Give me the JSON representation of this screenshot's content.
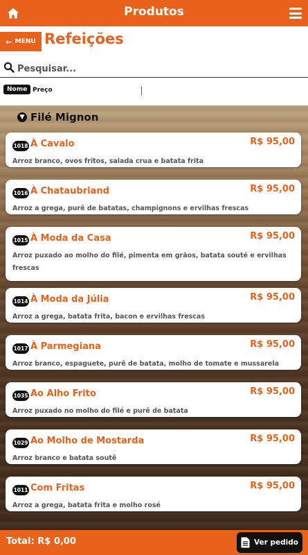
{
  "header": {
    "title": "Produtos",
    "home_icon": "home-icon",
    "menu_icon": "hamburger-icon"
  },
  "nav": {
    "menu_label": "MENU",
    "page_title": "Refeições"
  },
  "search": {
    "placeholder": "Pesquisar..."
  },
  "sort": {
    "nome_label": "Nome",
    "preco_label": "Preço"
  },
  "category": {
    "name": "Filé Mignon"
  },
  "items": [
    {
      "code": "1018",
      "name": "À Cavalo",
      "price": "R$ 95,00",
      "desc": "Arroz branco, ovos fritos, salada crua e batata frita"
    },
    {
      "code": "1016",
      "name": "À Chataubriand",
      "price": "R$ 95,00",
      "desc": "Arroz a grega, purê de batatas, champignons e ervilhas frescas"
    },
    {
      "code": "1015",
      "name": "À Moda da Casa",
      "price": "R$ 95,00",
      "desc": "Arroz puxado ao molho do filé, pimenta em grãos, batata souté e ervilhas frescas"
    },
    {
      "code": "1014",
      "name": "À Moda da Júlia",
      "price": "R$ 95,00",
      "desc": "Arroz a grega, batata frita, bacon e ervilhas frescas"
    },
    {
      "code": "1017",
      "name": "À Parmegiana",
      "price": "R$ 95,00",
      "desc": "Arroz branco, espaguete, purê de batata, molho de tomate e mussarela"
    },
    {
      "code": "1035",
      "name": "Ao Alho Frito",
      "price": "R$ 95,00",
      "desc": "Arroz puxado no molho do filé e purê de batata"
    },
    {
      "code": "1029",
      "name": "Ao Molho de Mostarda",
      "price": "R$ 95,00",
      "desc": "Arroz branco e batata soutê"
    },
    {
      "code": "1011",
      "name": "Com Fritas",
      "price": "R$ 95,00",
      "desc": "Arroz a grega, batata frita e molho rosé"
    }
  ],
  "footer": {
    "total": "Total: R$ 0,00",
    "ver_pedido": "Ver pedido",
    "doc_icon": "document-icon"
  },
  "colors": {
    "accent": "#e8621c",
    "dark": "#111111",
    "desc_text": "#555555"
  }
}
